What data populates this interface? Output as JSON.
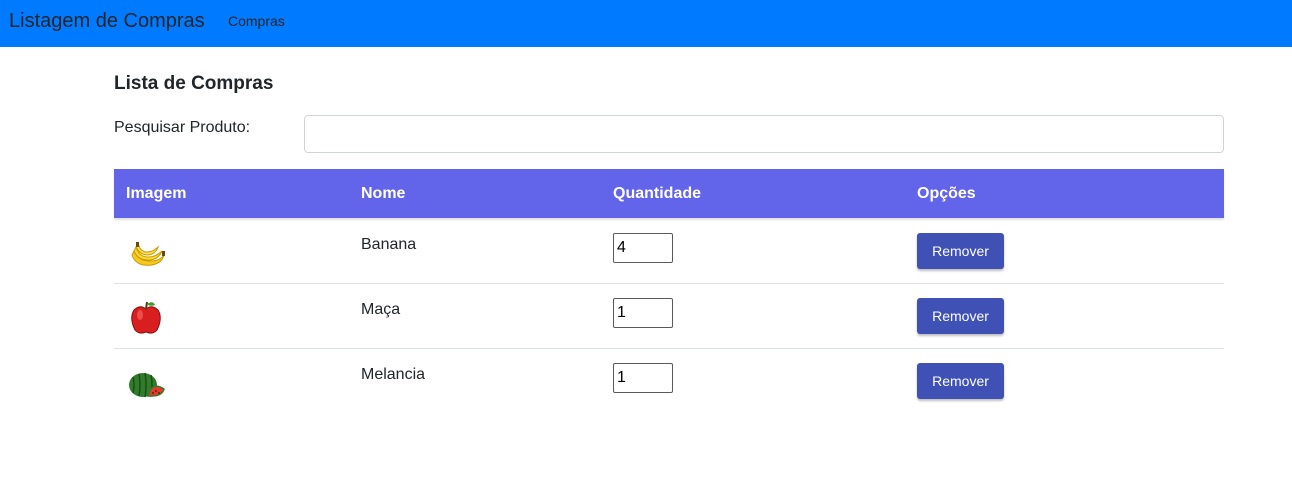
{
  "navbar": {
    "brand": "Listagem de Compras",
    "links": [
      "Compras"
    ],
    "background": "#007bff"
  },
  "main": {
    "title": "Lista de Compras",
    "search": {
      "label": "Pesquisar Produto:",
      "value": "",
      "placeholder": ""
    },
    "table": {
      "header_color": "#6264e9",
      "columns": [
        "Imagem",
        "Nome",
        "Quantidade",
        "Opções"
      ],
      "rows": [
        {
          "icon": "banana-icon",
          "name": "Banana",
          "quantity": "4",
          "action_label": "Remover"
        },
        {
          "icon": "apple-icon",
          "name": "Maça",
          "quantity": "1",
          "action_label": "Remover"
        },
        {
          "icon": "watermelon-icon",
          "name": "Melancia",
          "quantity": "1",
          "action_label": "Remover"
        }
      ]
    },
    "button_color": "#3f51b5"
  }
}
